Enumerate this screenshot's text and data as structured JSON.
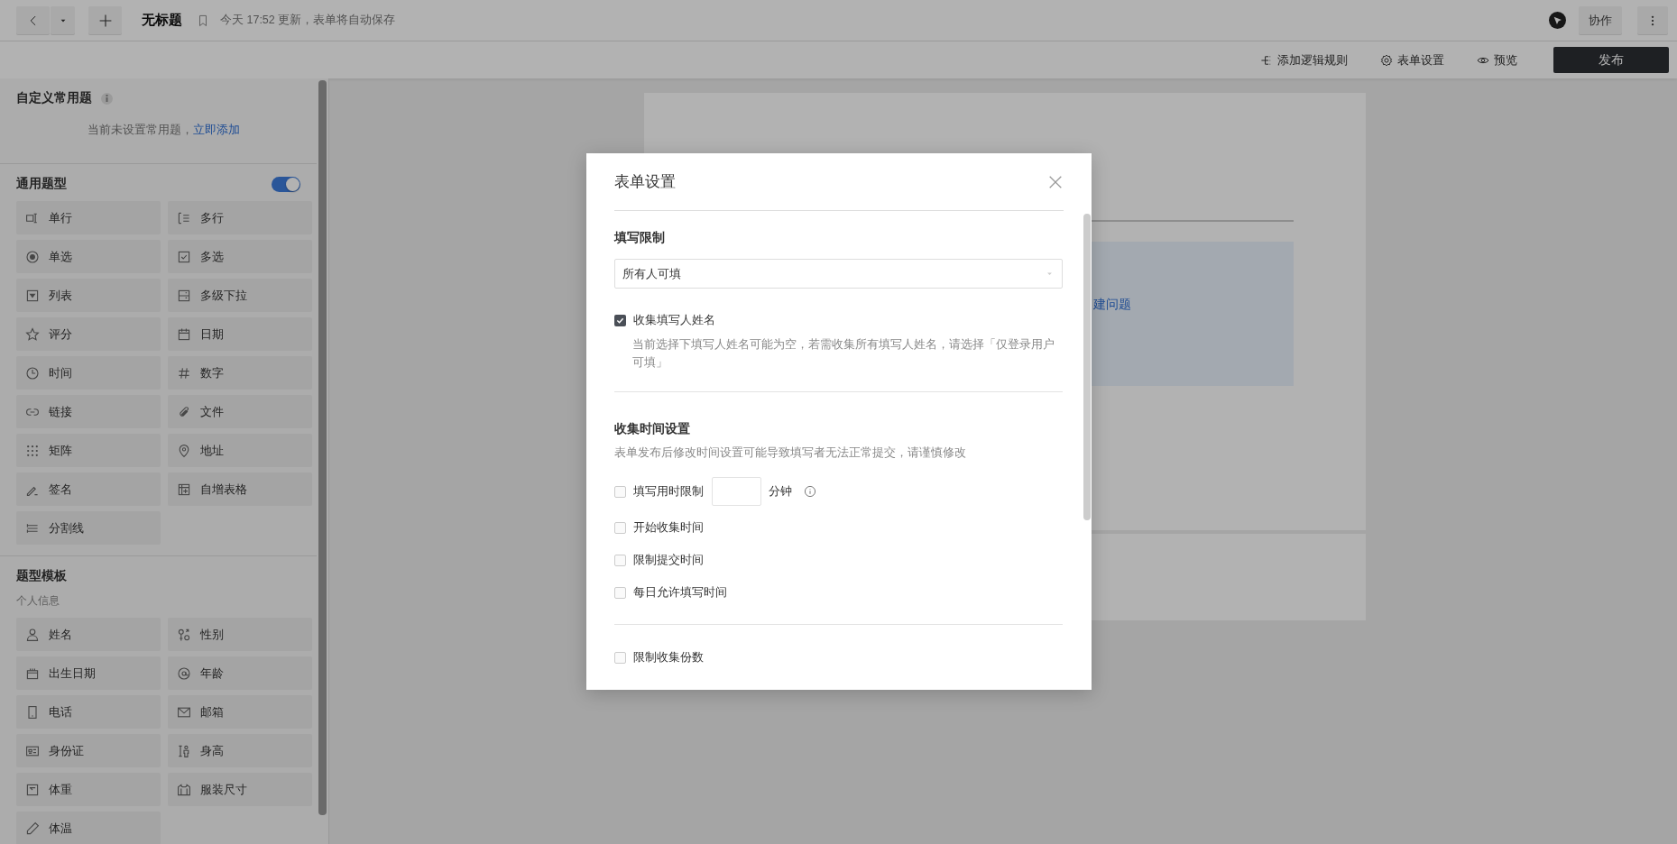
{
  "topbar": {
    "title": "无标题",
    "save_status": "今天 17:52 更新，表单将自动保存",
    "collab_button": "协作"
  },
  "toolbar": {
    "actions": [
      {
        "label": "添加逻辑规则"
      },
      {
        "label": "表单设置"
      },
      {
        "label": "预览"
      }
    ],
    "publish_button": "发布"
  },
  "sidebar": {
    "custom": {
      "title": "自定义常用题",
      "empty_text": "当前未设置常用题，",
      "add_link": "立即添加"
    },
    "general": {
      "title": "通用题型",
      "toggle_on": true,
      "items": [
        "单行",
        "多行",
        "单选",
        "多选",
        "列表",
        "多级下拉",
        "评分",
        "日期",
        "时间",
        "数字",
        "链接",
        "文件",
        "矩阵",
        "地址",
        "签名",
        "自增表格",
        "分割线"
      ]
    },
    "templates": {
      "title": "题型模板",
      "group": "个人信息",
      "items": [
        "姓名",
        "性别",
        "出生日期",
        "年龄",
        "电话",
        "邮箱",
        "身份证",
        "身高",
        "体重",
        "服装尺寸",
        "体温"
      ]
    }
  },
  "canvas": {
    "link_text": "建问题"
  },
  "dialog": {
    "title": "表单设置",
    "fill_limit": {
      "label": "填写限制",
      "value": "所有人可填"
    },
    "collect_name": {
      "label": "收集填写人姓名",
      "checked": true,
      "hint": "当前选择下填写人姓名可能为空，若需收集所有填写人姓名，请选择「仅登录用户可填」"
    },
    "time": {
      "title": "收集时间设置",
      "hint": "表单发布后修改时间设置可能导致填写者无法正常提交，请谨慎修改",
      "options": [
        {
          "kind": "duration",
          "label": "填写用时限制",
          "unit": "分钟",
          "checked": false
        },
        {
          "kind": "plain",
          "label": "开始收集时间",
          "checked": false
        },
        {
          "kind": "plain",
          "label": "限制提交时间",
          "checked": false
        },
        {
          "kind": "plain",
          "label": "每日允许填写时间",
          "checked": false
        }
      ]
    },
    "count_limit": {
      "label": "限制收集份数",
      "checked": false
    }
  }
}
